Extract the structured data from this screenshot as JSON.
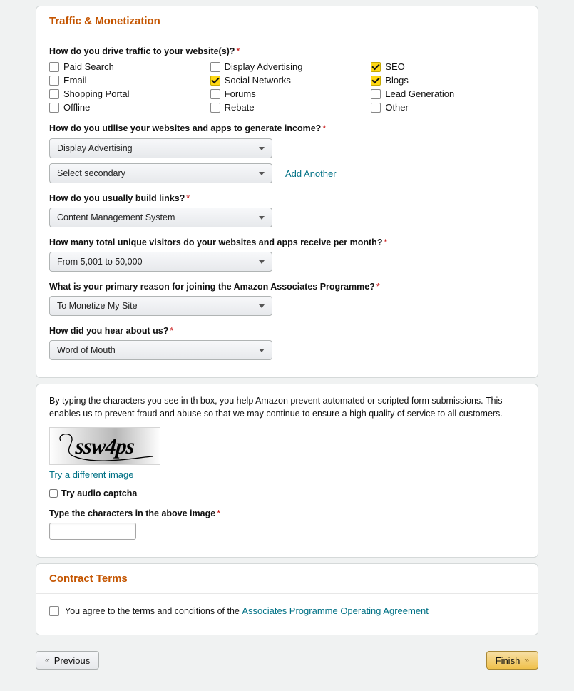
{
  "section_traffic": {
    "title": "Traffic & Monetization",
    "q_traffic": {
      "label": "How do you drive traffic to your website(s)?",
      "options": [
        {
          "label": "Paid Search",
          "checked": false
        },
        {
          "label": "Display Advertising",
          "checked": false
        },
        {
          "label": "SEO",
          "checked": true
        },
        {
          "label": "Email",
          "checked": false
        },
        {
          "label": "Social Networks",
          "checked": true
        },
        {
          "label": "Blogs",
          "checked": true
        },
        {
          "label": "Shopping Portal",
          "checked": false
        },
        {
          "label": "Forums",
          "checked": false
        },
        {
          "label": "Lead Generation",
          "checked": false
        },
        {
          "label": "Offline",
          "checked": false
        },
        {
          "label": "Rebate",
          "checked": false
        },
        {
          "label": "Other",
          "checked": false
        }
      ]
    },
    "q_income": {
      "label": "How do you utilise your websites and apps to generate income?",
      "primary": "Display Advertising",
      "secondary_placeholder": "Select secondary",
      "add_another": "Add Another"
    },
    "q_links": {
      "label": "How do you usually build links?",
      "value": "Content Management System"
    },
    "q_visitors": {
      "label": "How many total unique visitors do your websites and apps receive per month?",
      "value": "From 5,001 to 50,000"
    },
    "q_reason": {
      "label": "What is your primary reason for joining the Amazon Associates Programme?",
      "value": "To Monetize My Site"
    },
    "q_hear": {
      "label": "How did you hear about us?",
      "value": "Word of Mouth"
    }
  },
  "captcha": {
    "instructions": "By typing the characters you see in th box, you help Amazon prevent automated or scripted form submissions. This enables us to prevent fraud and abuse so that we may continue to ensure a high quality of service to all customers.",
    "image_text": "ssw4ps",
    "try_image_link": "Try a different image",
    "audio_label": "Try audio captcha",
    "type_label": "Type the characters in the above image"
  },
  "section_contract": {
    "title": "Contract Terms",
    "agree_prefix": "You agree to the terms and conditions of the ",
    "agree_link": "Associates Programme Operating Agreement"
  },
  "buttons": {
    "previous": "Previous",
    "finish": "Finish"
  }
}
